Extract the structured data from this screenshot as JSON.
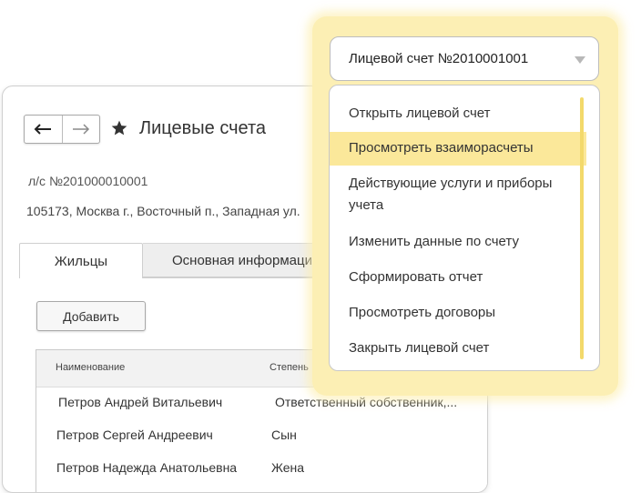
{
  "window": {
    "title": "Лицевые счета",
    "account": "л/с №201000010001",
    "address": "105173, Москва г., Восточный п., Западная ул.",
    "tabs": [
      "Жильцы",
      "Основная информация"
    ],
    "add_label": "Добавить",
    "table": {
      "headers": [
        "Наименование",
        "Степень"
      ],
      "rows": [
        [
          "Петров Андрей Витальевич",
          "Ответственный собственник,..."
        ],
        [
          "Петров Сергей Андреевич",
          "Сын"
        ],
        [
          "Петров Надежда Анатольевна",
          "Жена"
        ]
      ]
    }
  },
  "dropdown": {
    "selected": "Лицевой счет №2010001001",
    "items": [
      "Открыть лицевой счет",
      "Просмотреть взаиморасчеты",
      "Действующие услуги и приборы учета",
      "Изменить данные по счету",
      "Сформировать отчет",
      "Просмотреть договоры",
      "Закрыть лицевой счет"
    ],
    "active_index": 1
  },
  "icons": {
    "back": "arrow-left-icon",
    "forward": "arrow-right-icon",
    "favorite": "star-icon",
    "caret": "caret-down-icon"
  },
  "colors": {
    "panel_bg": "#fcefb4",
    "active_item": "#fbe89a",
    "scrollbar": "#f3d96b"
  }
}
